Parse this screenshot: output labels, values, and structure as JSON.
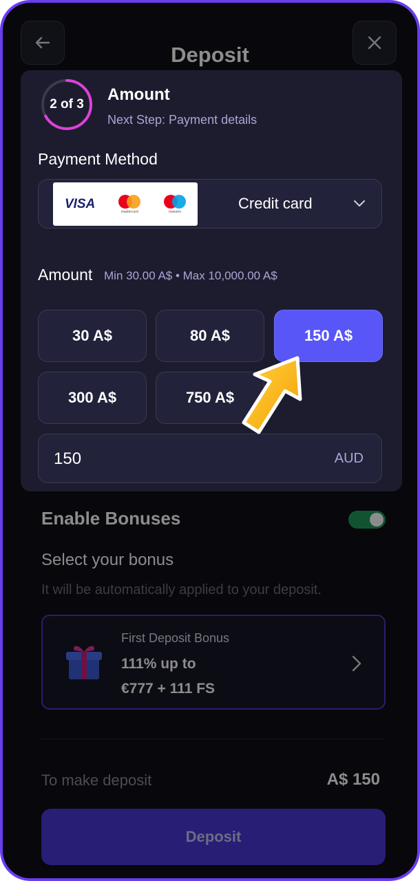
{
  "header": {
    "title": "Deposit"
  },
  "stepper": {
    "step": "2 of 3",
    "title": "Amount",
    "next": "Next Step: Payment details",
    "progress": 0.67
  },
  "payment": {
    "label": "Payment Method",
    "selected": "Credit card",
    "logos": [
      "VISA",
      "mastercard",
      "maestro"
    ]
  },
  "amount": {
    "label": "Amount",
    "range": "Min 30.00 A$ • Max 10,000.00 A$",
    "chips": [
      "30 A$",
      "80 A$",
      "150 A$",
      "300 A$",
      "750 A$"
    ],
    "selected_index": 2,
    "input_value": "150",
    "currency": "AUD"
  },
  "bonuses": {
    "enable_label": "Enable Bonuses",
    "enabled": true,
    "select_title": "Select your bonus",
    "select_subtitle": "It will be automatically applied to your deposit.",
    "card": {
      "small": "First Deposit Bonus",
      "line1": "111% up to",
      "line2": "€777 + 111 FS"
    }
  },
  "summary": {
    "label": "To make deposit",
    "value": "A$ 150"
  },
  "deposit_button": "Deposit",
  "colors": {
    "accent": "#5856f6",
    "frame": "#6a3cf0",
    "ring": "#e040d8",
    "toggle": "#1f9a5a"
  },
  "icons": [
    "back-arrow-icon",
    "close-icon",
    "chevron-down-icon",
    "chevron-right-icon",
    "gift-icon",
    "pointer-arrow-icon"
  ]
}
